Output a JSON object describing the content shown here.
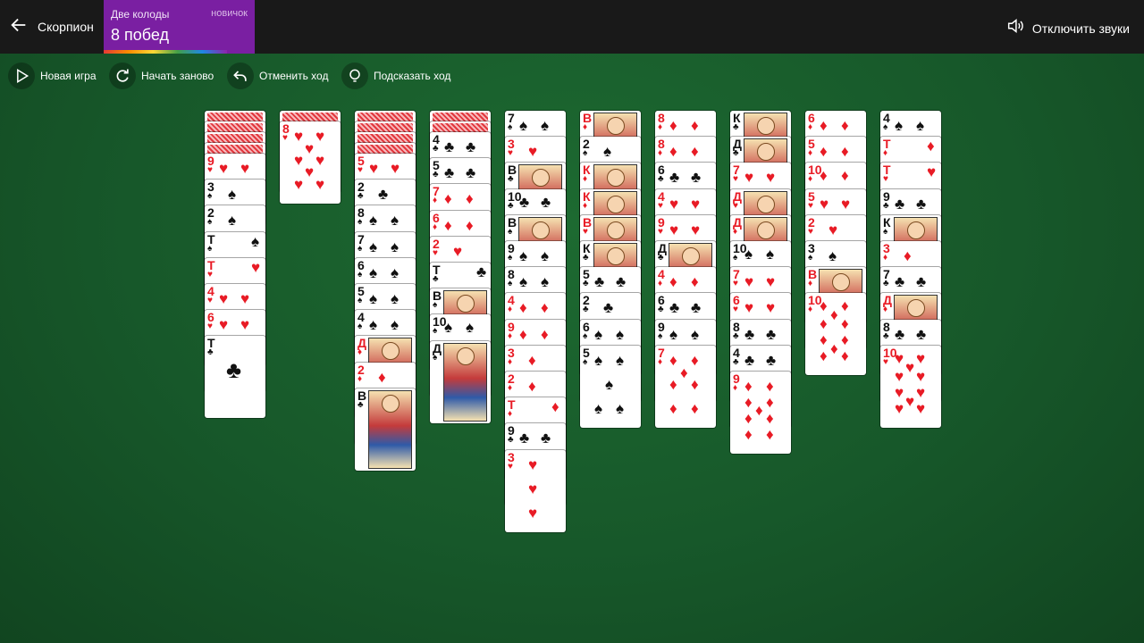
{
  "header": {
    "back_label": "Скорпион",
    "mode": {
      "name": "Две колоды",
      "level": "новичок",
      "wins": "8 побед"
    },
    "sound_label": "Отключить звуки"
  },
  "toolbar": {
    "new_game": "Новая игра",
    "restart": "Начать заново",
    "undo": "Отменить ход",
    "hint": "Подсказать ход"
  },
  "colors": {
    "felt": "#17582a",
    "topbar": "#191919",
    "mode_panel": "#7a1fa2",
    "red_suit": "#e81b25"
  },
  "columns": [
    {
      "cards": [
        {
          "back": true
        },
        {
          "back": true
        },
        {
          "back": true
        },
        {
          "back": true
        },
        {
          "rank": "9",
          "suit": "♥"
        },
        {
          "rank": "3",
          "suit": "♠"
        },
        {
          "rank": "2",
          "suit": "♠"
        },
        {
          "rank": "Т",
          "suit": "♠"
        },
        {
          "rank": "Т",
          "suit": "♥"
        },
        {
          "rank": "4",
          "suit": "♥"
        },
        {
          "rank": "6",
          "suit": "♥"
        },
        {
          "rank": "Т",
          "suit": "♣"
        }
      ]
    },
    {
      "cards": [
        {
          "back": true
        },
        {
          "rank": "8",
          "suit": "♥"
        }
      ]
    },
    {
      "cards": [
        {
          "back": true
        },
        {
          "back": true
        },
        {
          "back": true
        },
        {
          "back": true
        },
        {
          "rank": "5",
          "suit": "♥"
        },
        {
          "rank": "2",
          "suit": "♣"
        },
        {
          "rank": "8",
          "suit": "♠"
        },
        {
          "rank": "7",
          "suit": "♠"
        },
        {
          "rank": "6",
          "suit": "♠"
        },
        {
          "rank": "5",
          "suit": "♠"
        },
        {
          "rank": "4",
          "suit": "♠"
        },
        {
          "rank": "Д",
          "suit": "♦"
        },
        {
          "rank": "2",
          "suit": "♦"
        },
        {
          "rank": "В",
          "suit": "♣"
        }
      ]
    },
    {
      "cards": [
        {
          "back": true
        },
        {
          "back": true
        },
        {
          "rank": "4",
          "suit": "♣"
        },
        {
          "rank": "5",
          "suit": "♣"
        },
        {
          "rank": "7",
          "suit": "♦"
        },
        {
          "rank": "6",
          "suit": "♦"
        },
        {
          "rank": "2",
          "suit": "♥"
        },
        {
          "rank": "Т",
          "suit": "♣"
        },
        {
          "rank": "В",
          "suit": "♠"
        },
        {
          "rank": "10",
          "suit": "♠"
        },
        {
          "rank": "Д",
          "suit": "♠"
        }
      ]
    },
    {
      "cards": [
        {
          "rank": "7",
          "suit": "♠"
        },
        {
          "rank": "3",
          "suit": "♥"
        },
        {
          "rank": "В",
          "suit": "♣"
        },
        {
          "rank": "10",
          "suit": "♣"
        },
        {
          "rank": "В",
          "suit": "♠"
        },
        {
          "rank": "9",
          "suit": "♠"
        },
        {
          "rank": "8",
          "suit": "♠"
        },
        {
          "rank": "4",
          "suit": "♦"
        },
        {
          "rank": "9",
          "suit": "♦"
        },
        {
          "rank": "3",
          "suit": "♦"
        },
        {
          "rank": "2",
          "suit": "♦"
        },
        {
          "rank": "Т",
          "suit": "♦"
        },
        {
          "rank": "9",
          "suit": "♣"
        },
        {
          "rank": "3",
          "suit": "♥"
        }
      ]
    },
    {
      "cards": [
        {
          "rank": "В",
          "suit": "♦"
        },
        {
          "rank": "2",
          "suit": "♠"
        },
        {
          "rank": "К",
          "suit": "♦"
        },
        {
          "rank": "К",
          "suit": "♦"
        },
        {
          "rank": "В",
          "suit": "♥"
        },
        {
          "rank": "К",
          "suit": "♣"
        },
        {
          "rank": "5",
          "suit": "♣"
        },
        {
          "rank": "2",
          "suit": "♣"
        },
        {
          "rank": "6",
          "suit": "♠"
        },
        {
          "rank": "5",
          "suit": "♠"
        }
      ]
    },
    {
      "cards": [
        {
          "rank": "8",
          "suit": "♦"
        },
        {
          "rank": "8",
          "suit": "♦"
        },
        {
          "rank": "6",
          "suit": "♣"
        },
        {
          "rank": "4",
          "suit": "♥"
        },
        {
          "rank": "9",
          "suit": "♥"
        },
        {
          "rank": "Д",
          "suit": "♣"
        },
        {
          "rank": "4",
          "suit": "♦"
        },
        {
          "rank": "6",
          "suit": "♣"
        },
        {
          "rank": "9",
          "suit": "♠"
        },
        {
          "rank": "7",
          "suit": "♦"
        }
      ]
    },
    {
      "cards": [
        {
          "rank": "К",
          "suit": "♣"
        },
        {
          "rank": "Д",
          "suit": "♣"
        },
        {
          "rank": "7",
          "suit": "♥"
        },
        {
          "rank": "Д",
          "suit": "♥"
        },
        {
          "rank": "Д",
          "suit": "♦"
        },
        {
          "rank": "10",
          "suit": "♠"
        },
        {
          "rank": "7",
          "suit": "♥"
        },
        {
          "rank": "6",
          "suit": "♥"
        },
        {
          "rank": "8",
          "suit": "♣"
        },
        {
          "rank": "4",
          "suit": "♣"
        },
        {
          "rank": "9",
          "suit": "♦"
        }
      ]
    },
    {
      "cards": [
        {
          "rank": "6",
          "suit": "♦"
        },
        {
          "rank": "5",
          "suit": "♦"
        },
        {
          "rank": "10",
          "suit": "♦"
        },
        {
          "rank": "5",
          "suit": "♥"
        },
        {
          "rank": "2",
          "suit": "♥"
        },
        {
          "rank": "3",
          "suit": "♠"
        },
        {
          "rank": "В",
          "suit": "♦"
        },
        {
          "rank": "10",
          "suit": "♦"
        }
      ]
    },
    {
      "cards": [
        {
          "rank": "4",
          "suit": "♠"
        },
        {
          "rank": "Т",
          "suit": "♦"
        },
        {
          "rank": "Т",
          "suit": "♥"
        },
        {
          "rank": "9",
          "suit": "♣"
        },
        {
          "rank": "К",
          "suit": "♠"
        },
        {
          "rank": "3",
          "suit": "♦"
        },
        {
          "rank": "7",
          "suit": "♣"
        },
        {
          "rank": "Д",
          "suit": "♦"
        },
        {
          "rank": "8",
          "suit": "♣"
        },
        {
          "rank": "10",
          "suit": "♥"
        }
      ]
    }
  ]
}
